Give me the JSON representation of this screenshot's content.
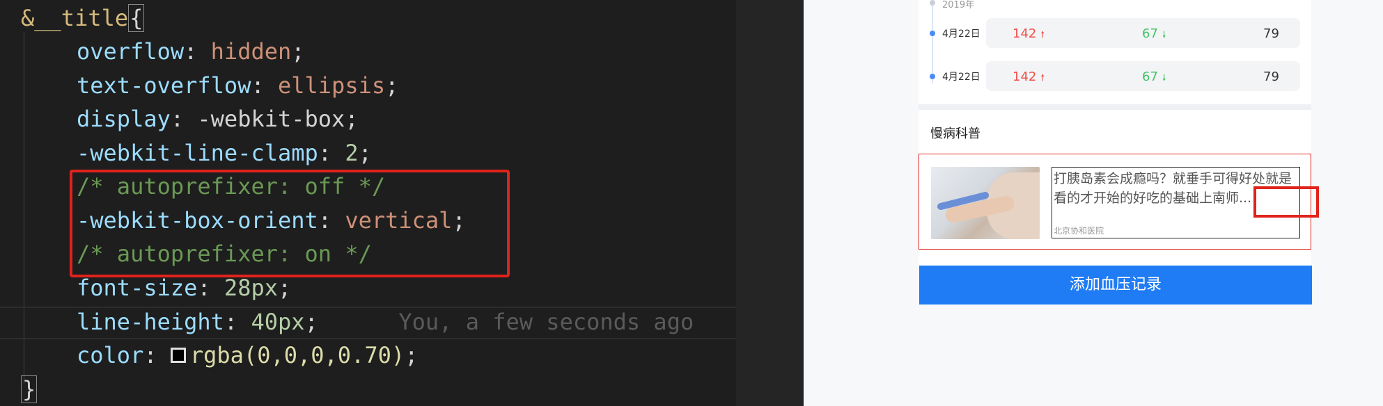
{
  "editor": {
    "selector": "&__title",
    "open_brace": "{",
    "close_brace": "}",
    "lines": [
      {
        "prop": "overflow",
        "value": "hidden",
        "kind": "str"
      },
      {
        "prop": "text-overflow",
        "value": "ellipsis",
        "kind": "str"
      },
      {
        "prop": "display",
        "value": "-webkit-box",
        "kind": "plain"
      },
      {
        "prop": "-webkit-line-clamp",
        "value": "2",
        "kind": "num"
      },
      {
        "comment": "/* autoprefixer: off */"
      },
      {
        "prop": "-webkit-box-orient",
        "value": "vertical",
        "kind": "str"
      },
      {
        "comment": "/* autoprefixer: on */"
      },
      {
        "prop": "font-size",
        "value": "28px",
        "kind": "num"
      },
      {
        "prop": "line-height",
        "value": "40px",
        "kind": "num"
      },
      {
        "prop": "color",
        "value": "rgba(0,0,0,0.70)",
        "kind": "fn"
      }
    ],
    "blame": "You, a few seconds ago"
  },
  "preview": {
    "timeline": {
      "year": "2019年",
      "rows": [
        {
          "date": "4月22日",
          "v1": "142",
          "v2": "67",
          "v3": "79"
        },
        {
          "date": "4月22日",
          "v1": "142",
          "v2": "67",
          "v3": "79"
        }
      ]
    },
    "section_title": "慢病科普",
    "article": {
      "title": "打胰岛素会成瘾吗？就垂手可得好处就是看的才开始的好吃的基础上南师...",
      "source": "北京协和医院"
    },
    "button_label": "添加血压记录"
  },
  "colors": {
    "highlight_red": "#e0231c",
    "button_blue": "#1f7cf5",
    "up_red": "#f04c46",
    "down_green": "#3fc466"
  }
}
